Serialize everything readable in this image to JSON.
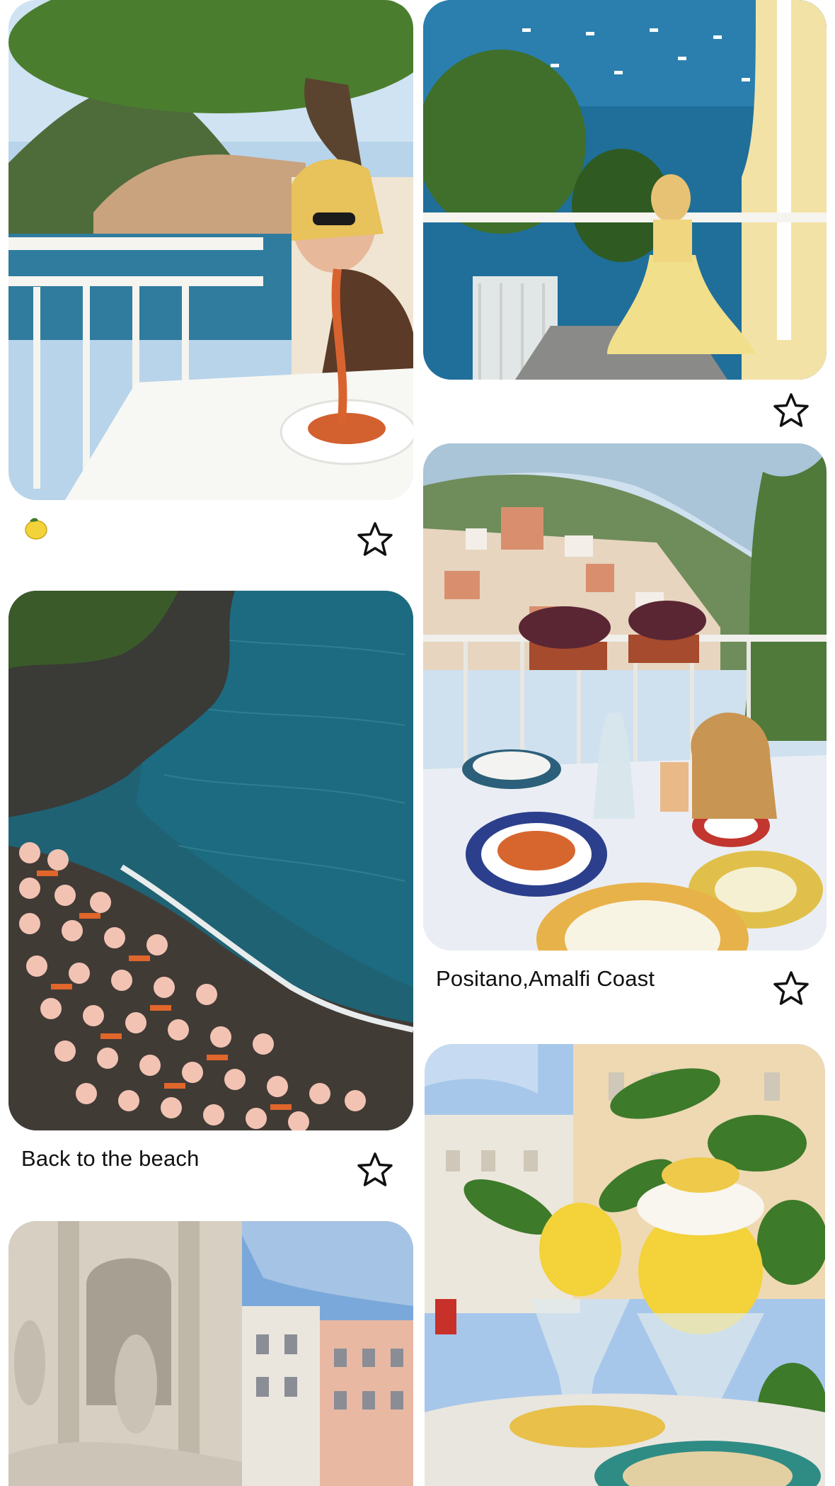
{
  "feed": {
    "pins": [
      {
        "id": "pin-1",
        "caption": "",
        "caption_icon": "lemon-icon",
        "save_icon": "star-icon",
        "image_subject": "woman-eating-spaghetti-balcony"
      },
      {
        "id": "pin-2",
        "caption": "",
        "save_icon": "star-icon",
        "image_subject": "woman-yellow-dress-stairs-sea"
      },
      {
        "id": "pin-3",
        "caption": "Positano,Amalfi Coast",
        "save_icon": "star-icon",
        "image_subject": "table-view-positano"
      },
      {
        "id": "pin-4",
        "caption": "Back to the beach",
        "save_icon": "star-icon",
        "image_subject": "beach-umbrellas-aerial"
      },
      {
        "id": "pin-5",
        "caption": "",
        "image_subject": "trevi-fountain"
      },
      {
        "id": "pin-6",
        "caption": "",
        "image_subject": "lemon-sorbet-cafe"
      }
    ]
  },
  "colors": {
    "sea": "#1f6f9a",
    "sky": "#a8cdea",
    "star_stroke": "#111111",
    "umbrella": "#f2c3b3",
    "lemon": "#f3d23a",
    "leaf": "#3d7a2a"
  }
}
